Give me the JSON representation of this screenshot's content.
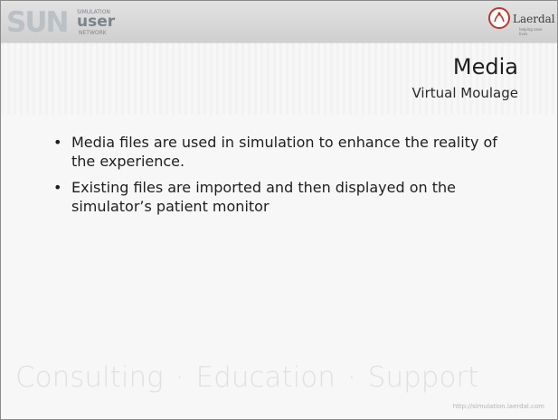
{
  "header": {
    "logo_big": "SUN",
    "logo_small_top": "SIMULATION",
    "logo_user": "user",
    "logo_small_bottom": "NETWORK",
    "brand_name": "Laerdal",
    "brand_tagline": "helping save lives"
  },
  "slide": {
    "title": "Media",
    "subtitle": "Virtual Moulage",
    "bullets": [
      "Media files are used in simulation to enhance the reality of the experience.",
      "Existing files are imported and then displayed on the simulator’s patient monitor"
    ],
    "bullet_symbol": "•"
  },
  "footer": {
    "words": [
      "Consulting",
      "Education",
      "Support"
    ],
    "separator": "·",
    "url": "http://simulation.laerdal.com"
  }
}
